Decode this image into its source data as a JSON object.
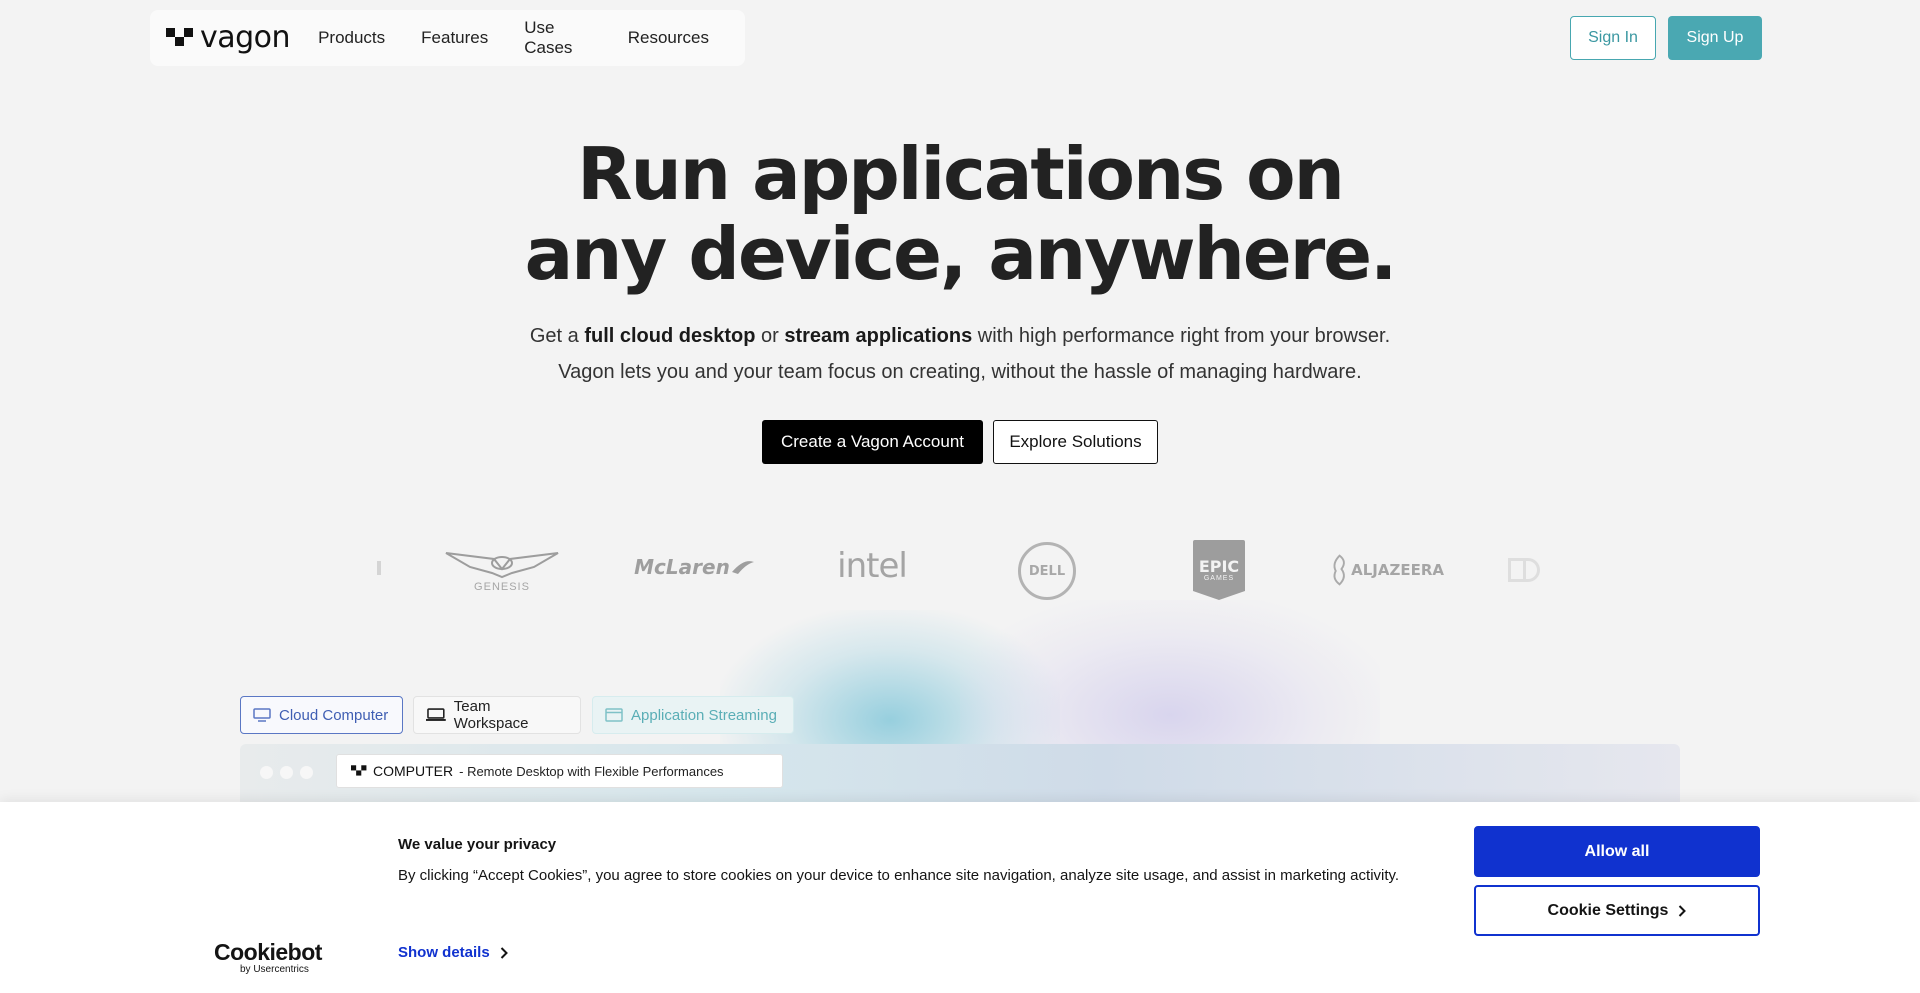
{
  "header": {
    "logo_text": "vagon",
    "nav": [
      "Products",
      "Features",
      "Use Cases",
      "Resources"
    ],
    "sign_in": "Sign In",
    "sign_up": "Sign Up"
  },
  "hero": {
    "title_line1": "Run applications on",
    "title_line2": "any device, anywhere.",
    "sub1_a": "Get a ",
    "sub1_b": "full cloud desktop",
    "sub1_c": " or ",
    "sub1_d": "stream applications",
    "sub1_e": " with high performance right from your browser.",
    "sub2": "Vagon lets you and your team focus on creating, without the hassle of managing hardware.",
    "cta_primary": "Create a Vagon Account",
    "cta_secondary": "Explore Solutions"
  },
  "brands": {
    "genesis": "GENESIS",
    "mclaren": "McLaren",
    "intel": "intel",
    "dell": "DELL",
    "epic_top": "EPIC",
    "epic_bottom": "GAMES",
    "aljazeera": "ALJAZEERA"
  },
  "product_tabs": {
    "cloud": "Cloud Computer",
    "team": "Team Workspace",
    "app": "Application Streaming"
  },
  "preview": {
    "url_strong": "COMPUTER",
    "url_text": "- Remote Desktop with Flexible Performances"
  },
  "cookie": {
    "title": "We value your privacy",
    "text": "By clicking “Accept Cookies”, you agree to store cookies on your device to enhance site navigation, analyze site usage, and assist in marketing activity.",
    "show_details": "Show details",
    "allow_all": "Allow all",
    "settings": "Cookie Settings",
    "logo_main": "Cookiebot",
    "logo_sub": "by Usercentrics"
  },
  "colors": {
    "accent": "#4aa8b2",
    "cookie_blue": "#1032cf",
    "cloud_tab": "#3f5eb3"
  }
}
